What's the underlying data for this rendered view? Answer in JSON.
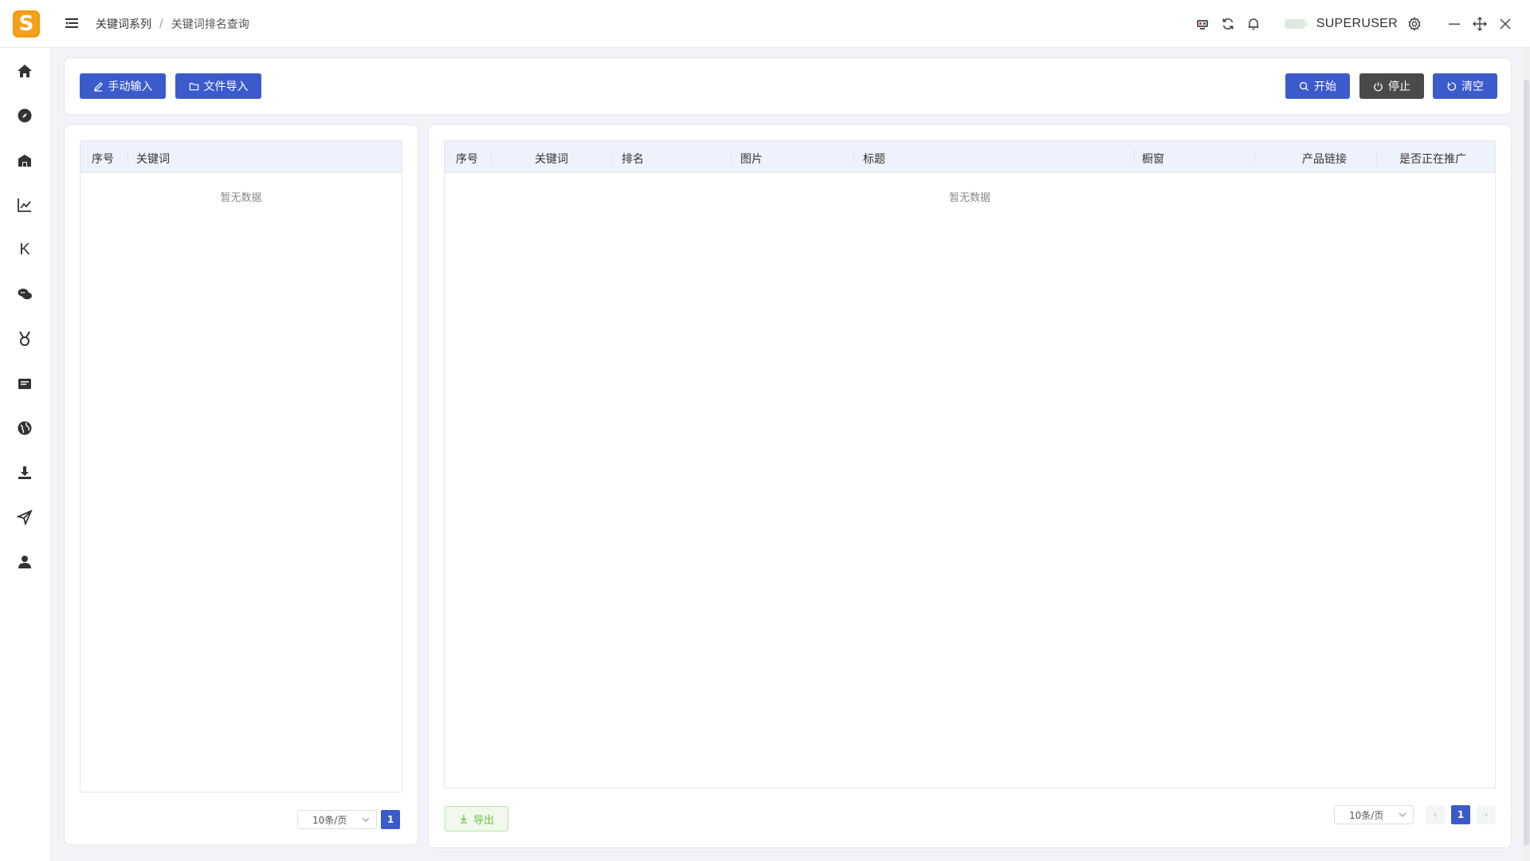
{
  "header": {
    "logo_letter": "S",
    "breadcrumb": [
      "关键词系列",
      "关键词排名查询"
    ],
    "breadcrumb_sep": "/",
    "username": "SUPERUSER",
    "icons": [
      "monitor-icon",
      "refresh-icon",
      "bell-icon",
      "battery-icon",
      "gear-icon",
      "minimize-icon",
      "move-icon",
      "close-icon"
    ]
  },
  "sidebar": {
    "items": [
      {
        "icon": "home-icon"
      },
      {
        "icon": "compass-icon"
      },
      {
        "icon": "store-icon"
      },
      {
        "icon": "trend-chart-icon"
      },
      {
        "icon": "k-letter-icon",
        "label": "K"
      },
      {
        "icon": "chat-icon"
      },
      {
        "icon": "medal-icon"
      },
      {
        "icon": "inbox-icon"
      },
      {
        "icon": "globe-icon"
      },
      {
        "icon": "download-icon"
      },
      {
        "icon": "send-icon"
      },
      {
        "icon": "user-icon"
      }
    ]
  },
  "toolbar": {
    "manual_input": "手动输入",
    "file_import": "文件导入",
    "start": "开始",
    "stop": "停止",
    "clear": "清空"
  },
  "left_table": {
    "columns": [
      "序号",
      "关键词"
    ],
    "empty_text": "暂无数据",
    "page_size": "10条/页",
    "current_page": "1"
  },
  "right_table": {
    "columns": [
      "序号",
      "关键词",
      "排名",
      "图片",
      "标题",
      "橱窗",
      "产品链接",
      "是否正在推广"
    ],
    "empty_text": "暂无数据",
    "export_label": "导出",
    "page_size": "10条/页",
    "current_page": "1",
    "prev": "‹",
    "next": "›"
  },
  "colors": {
    "primary": "#3b5bcc",
    "dark_button": "#4a4a4a",
    "logo": "#f7a21b",
    "export_green": "#67c23a",
    "table_header": "#edf2fc"
  }
}
